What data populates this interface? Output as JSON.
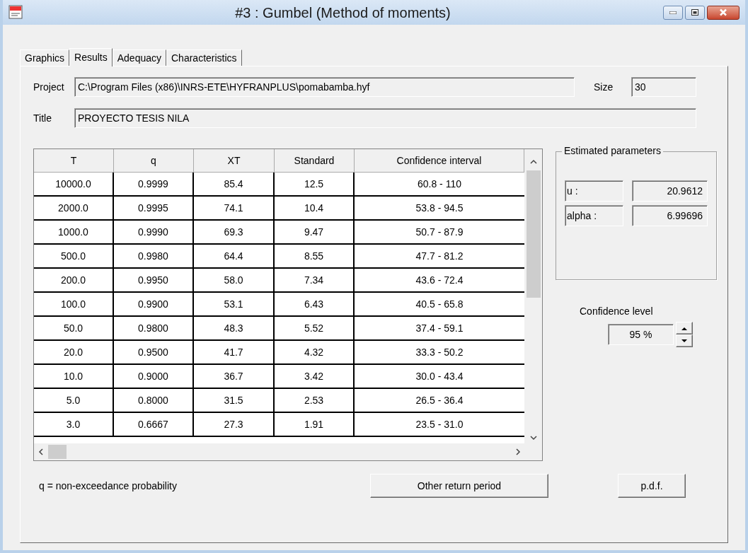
{
  "window": {
    "title": "#3 : Gumbel (Method of moments)"
  },
  "tabs": [
    {
      "label": "Graphics",
      "selected": false
    },
    {
      "label": "Results",
      "selected": true
    },
    {
      "label": "Adequacy",
      "selected": false
    },
    {
      "label": "Characteristics",
      "selected": false
    }
  ],
  "project": {
    "label": "Project",
    "value": "C:\\Program Files (x86)\\INRS-ETE\\HYFRANPLUS\\pomabamba.hyf"
  },
  "size": {
    "label": "Size",
    "value": "30"
  },
  "title_field": {
    "label": "Title",
    "value": "PROYECTO TESIS NILA"
  },
  "table": {
    "columns": [
      "T",
      "q",
      "XT",
      "Standard",
      "Confidence interval"
    ],
    "rows": [
      [
        "10000.0",
        "0.9999",
        "85.4",
        "12.5",
        "60.8 - 110"
      ],
      [
        "2000.0",
        "0.9995",
        "74.1",
        "10.4",
        "53.8 - 94.5"
      ],
      [
        "1000.0",
        "0.9990",
        "69.3",
        "9.47",
        "50.7 - 87.9"
      ],
      [
        "500.0",
        "0.9980",
        "64.4",
        "8.55",
        "47.7 - 81.2"
      ],
      [
        "200.0",
        "0.9950",
        "58.0",
        "7.34",
        "43.6 - 72.4"
      ],
      [
        "100.0",
        "0.9900",
        "53.1",
        "6.43",
        "40.5 - 65.8"
      ],
      [
        "50.0",
        "0.9800",
        "48.3",
        "5.52",
        "37.4 - 59.1"
      ],
      [
        "20.0",
        "0.9500",
        "41.7",
        "4.32",
        "33.3 - 50.2"
      ],
      [
        "10.0",
        "0.9000",
        "36.7",
        "3.42",
        "30.0 - 43.4"
      ],
      [
        "5.0",
        "0.8000",
        "31.5",
        "2.53",
        "26.5 - 36.4"
      ],
      [
        "3.0",
        "0.6667",
        "27.3",
        "1.91",
        "23.5 - 31.0"
      ]
    ]
  },
  "estimated_parameters": {
    "title": "Estimated parameters",
    "params": [
      {
        "name": "u :",
        "value": "20.9612"
      },
      {
        "name": "alpha :",
        "value": "6.99696"
      }
    ]
  },
  "confidence_level": {
    "label": "Confidence level",
    "value": "95 %"
  },
  "footnote": "q = non-exceedance probability",
  "buttons": {
    "other": "Other return period",
    "pdf": "p.d.f."
  }
}
